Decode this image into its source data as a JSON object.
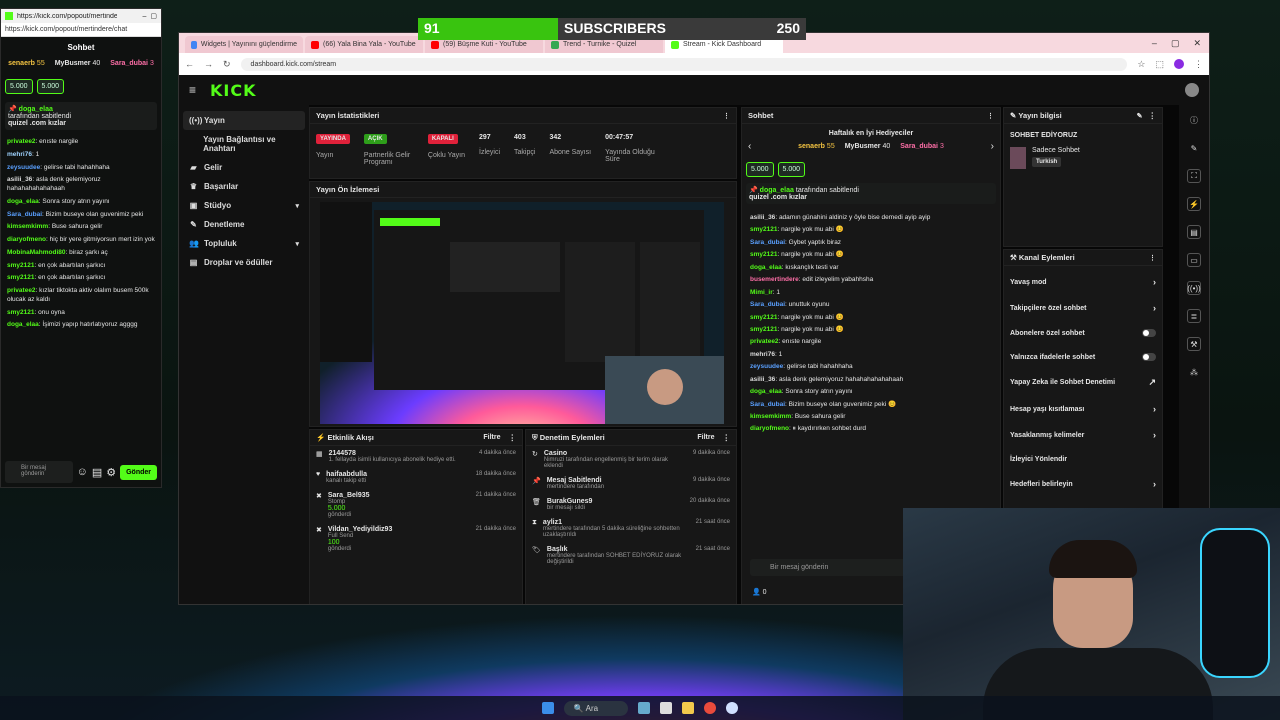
{
  "overlay": {
    "sub_count": "91",
    "sub_label": "SUBSCRIBERS",
    "sub_goal": "250"
  },
  "popout": {
    "url": "https://kick.com/popout/mertindere/chat",
    "title": "Sohbet",
    "gifters": [
      {
        "name": "senaerb",
        "count": "55"
      },
      {
        "name": "MyBusmer",
        "count": "40"
      },
      {
        "name": "Sara_dubai",
        "count": "3"
      }
    ],
    "chips": [
      "5.000",
      "5.000"
    ],
    "pinned": {
      "user": "doga_elaa",
      "by": "tarafından sabitlendi",
      "text": "quizel .com kızlar"
    },
    "messages": [
      {
        "user": "privatee2",
        "color": "#53fc18",
        "text": "enıste nargile"
      },
      {
        "user": "mehri76",
        "color": "#9fd3ff",
        "text": "1"
      },
      {
        "user": "zeysuudee",
        "color": "#5aa0ff",
        "text": "gelirse tabi hahahhaha"
      },
      {
        "user": "asilii_36",
        "color": "#ddd",
        "text": "asla denk gelemiyoruz hahahahahahahaah"
      },
      {
        "user": "doga_elaa",
        "color": "#53fc18",
        "text": "Sonra story atrın yayını"
      },
      {
        "user": "Sara_dubai",
        "color": "#5aa0ff",
        "text": "Bizim buseye olan guvenimiz peki"
      },
      {
        "user": "kimsemkimm",
        "color": "#53fc18",
        "text": "Buse sahura gelir"
      },
      {
        "user": "diaryofmeno",
        "color": "#53fc18",
        "text": "hiç bir yere gitmiyorsun mert izin yok"
      },
      {
        "user": "MobinaMahmodi80",
        "color": "#53fc18",
        "text": "biraz şarkı aç"
      },
      {
        "user": "smy2121",
        "color": "#53fc18",
        "text": "en çok abartılan şarkıcı"
      },
      {
        "user": "smy2121",
        "color": "#53fc18",
        "text": "en çok abartılan şarkıcı"
      },
      {
        "user": "privatee2",
        "color": "#53fc18",
        "text": "kızlar tiktokta aktiv olalım busem 500k olucak az kaldı"
      },
      {
        "user": "smy2121",
        "color": "#53fc18",
        "text": "onu oyna"
      },
      {
        "user": "doga_elaa",
        "color": "#53fc18",
        "text": "İşimizi yapıp hatırlatıyoruz agggg"
      }
    ],
    "input_placeholder": "Bir mesaj gönderin",
    "send": "Gönder"
  },
  "browser": {
    "tabs": [
      "Widgets | Yayınını güçlendirme",
      "(66) Yala Bina Yala - YouTube",
      "(59) Büşme Kuti - YouTube",
      "Trend - Turnike - Quizel",
      "Stream - Kick Dashboard"
    ],
    "url": "dashboard.kick.com/stream"
  },
  "kick": {
    "logo": "KICK",
    "nav": [
      {
        "label": "Yayın",
        "icon": "((•))",
        "active": true
      },
      {
        "label": "Yayın Bağlantısı ve Anahtarı",
        "icon": ""
      },
      {
        "label": "Gelir",
        "icon": "▰"
      },
      {
        "label": "Başarılar",
        "icon": "♛"
      },
      {
        "label": "Stüdyo",
        "icon": "▣",
        "chev": "▾"
      },
      {
        "label": "Denetleme",
        "icon": "✎"
      },
      {
        "label": "Topluluk",
        "icon": "👥",
        "chev": "▾"
      },
      {
        "label": "Droplar ve ödüller",
        "icon": "▤"
      }
    ],
    "stats_title": "Yayın İstatistikleri",
    "stats": [
      {
        "value": "YAYINDA",
        "label": "Yayın",
        "badge": "#e0213a"
      },
      {
        "value": "AÇIK",
        "label": "Partnerlik Gelir Programı",
        "badge": "#2e9e1a"
      },
      {
        "value": "KAPALI",
        "label": "Çoklu Yayın",
        "badge": "#e0213a"
      },
      {
        "value": "297",
        "label": "İzleyici"
      },
      {
        "value": "403",
        "label": "Takipçi"
      },
      {
        "value": "342",
        "label": "Abone Sayısı"
      },
      {
        "value": "00:47:57",
        "label": "Yayında Olduğu Süre"
      }
    ],
    "preview_title": "Yayın Ön İzlemesi",
    "activity": {
      "title": "Etkinlik Akışı",
      "filter": "Filtre",
      "items": [
        {
          "name": "2144578",
          "sub": "1. fellayda isimli kullanıcıya abonelik hediye etti.",
          "time": "4 dakika önce"
        },
        {
          "name": "haifaabdulla",
          "sub": "kanalı takip etti",
          "time": "18 dakika önce"
        },
        {
          "name": "Sara_Bel935",
          "sub": "Stomp",
          "amount": "5.000",
          "extra": "gönderdi",
          "time": "21 dakika önce"
        },
        {
          "name": "Vildan_Yediyildiz93",
          "sub": "Full Send",
          "amount": "100",
          "extra": "gönderdi",
          "time": "21 dakika önce"
        }
      ]
    },
    "mod": {
      "title": "Denetim Eylemleri",
      "filter": "Filtre",
      "items": [
        {
          "name": "Casino",
          "sub": "Nimruzi tarafından engellenmiş bir terim olarak eklendi",
          "time": "9 dakika önce"
        },
        {
          "name": "Mesaj Sabitlendi",
          "sub": "mertindere tarafından",
          "time": "9 dakika önce"
        },
        {
          "name": "BurakGunes9",
          "sub": "bir mesajı sildi",
          "time": "20 dakika önce"
        },
        {
          "name": "ayliz1",
          "sub": "mertindere tarafından 5 dakika süreliğine sohbetten uzaklaştırıldı",
          "time": "21 saat önce"
        },
        {
          "name": "Başlık",
          "sub": "mertindere tarafından SOHBET EDİYORUZ olarak değiştirildi",
          "time": "21 saat önce"
        }
      ]
    },
    "chat": {
      "title": "Sohbet",
      "leader_title": "Haftalık en İyi Hediyeciler",
      "leaders": [
        {
          "name": "senaerb",
          "count": "55"
        },
        {
          "name": "MyBusmer",
          "count": "40"
        },
        {
          "name": "Sara_dubai",
          "count": "3"
        }
      ],
      "chips": [
        "5.000",
        "5.000"
      ],
      "pinned": {
        "user": "doga_elaa",
        "by": "tarafından sabitlendi",
        "text": "quizel .com kızlar"
      },
      "messages": [
        {
          "user": "asilii_36",
          "color": "#ddd",
          "text": "adamın günahini aldiniz y öyle bise demedi ayip ayip"
        },
        {
          "user": "smy2121",
          "color": "#53fc18",
          "text": "nargile yok mu abi 😊"
        },
        {
          "user": "Sara_dubai",
          "color": "#5aa0ff",
          "text": "Gybet yaptık biraz"
        },
        {
          "user": "smy2121",
          "color": "#53fc18",
          "text": "nargile yok mu abi 😊"
        },
        {
          "user": "doga_elaa",
          "color": "#53fc18",
          "text": "kıskançlık testi var"
        },
        {
          "user": "busemertindere",
          "color": "#ff6fa8",
          "text": "edit izleyelim yabahhsha"
        },
        {
          "user": "Mimi_ir",
          "color": "#53fc18",
          "text": "1"
        },
        {
          "user": "Sara_dubai",
          "color": "#5aa0ff",
          "text": "unuttuk oyunu"
        },
        {
          "user": "smy2121",
          "color": "#53fc18",
          "text": "nargile yok mu abi 😊"
        },
        {
          "user": "smy2121",
          "color": "#53fc18",
          "text": "nargile yok mu abi 😊"
        },
        {
          "user": "privatee2",
          "color": "#53fc18",
          "text": "enıste nargile"
        },
        {
          "user": "mehri76",
          "color": "#ddd",
          "text": "1"
        },
        {
          "user": "zeysuudee",
          "color": "#5aa0ff",
          "text": "gelirse tabi hahahhaha"
        },
        {
          "user": "asilii_36",
          "color": "#ddd",
          "text": "asla denk gelemiyoruz hahahahahahahaah"
        },
        {
          "user": "doga_elaa",
          "color": "#53fc18",
          "text": "Sonra story atrın yayını"
        },
        {
          "user": "Sara_dubai",
          "color": "#5aa0ff",
          "text": "Bizim buseye olan guvenimiz peki 😊"
        },
        {
          "user": "kimsemkimm",
          "color": "#53fc18",
          "text": "Buse sahura gelir"
        },
        {
          "user": "diaryofmeno",
          "color": "#53fc18",
          "text": "⏸ kaydırırken sohbet durd"
        }
      ],
      "input_placeholder": "Bir mesaj gönderin",
      "viewers": "0"
    },
    "info": {
      "title": "Yayın bilgisi",
      "stream_title": "SOHBET EDİYORUZ",
      "category": "Sadece Sohbet",
      "language": "Turkish"
    },
    "actions": {
      "title": "Kanal Eylemleri",
      "items": [
        {
          "label": "Yavaş mod",
          "end": "›"
        },
        {
          "label": "Takipçilere özel sohbet",
          "end": "›"
        },
        {
          "label": "Abonelere özel sohbet",
          "end": "toggle"
        },
        {
          "label": "Yalnızca ifadelerle sohbet",
          "end": "toggle"
        },
        {
          "label": "Yapay Zeka ile Sohbet Denetimi",
          "end": "↗"
        },
        {
          "label": "Hesap yaşı kısıtlaması",
          "end": "›"
        },
        {
          "label": "Yasaklanmış kelimeler",
          "end": "›"
        },
        {
          "label": "İzleyici Yönlendir",
          "end": ""
        },
        {
          "label": "Hedefleri belirleyin",
          "end": "›"
        }
      ]
    }
  },
  "taskbar": {
    "search": "Ara"
  }
}
